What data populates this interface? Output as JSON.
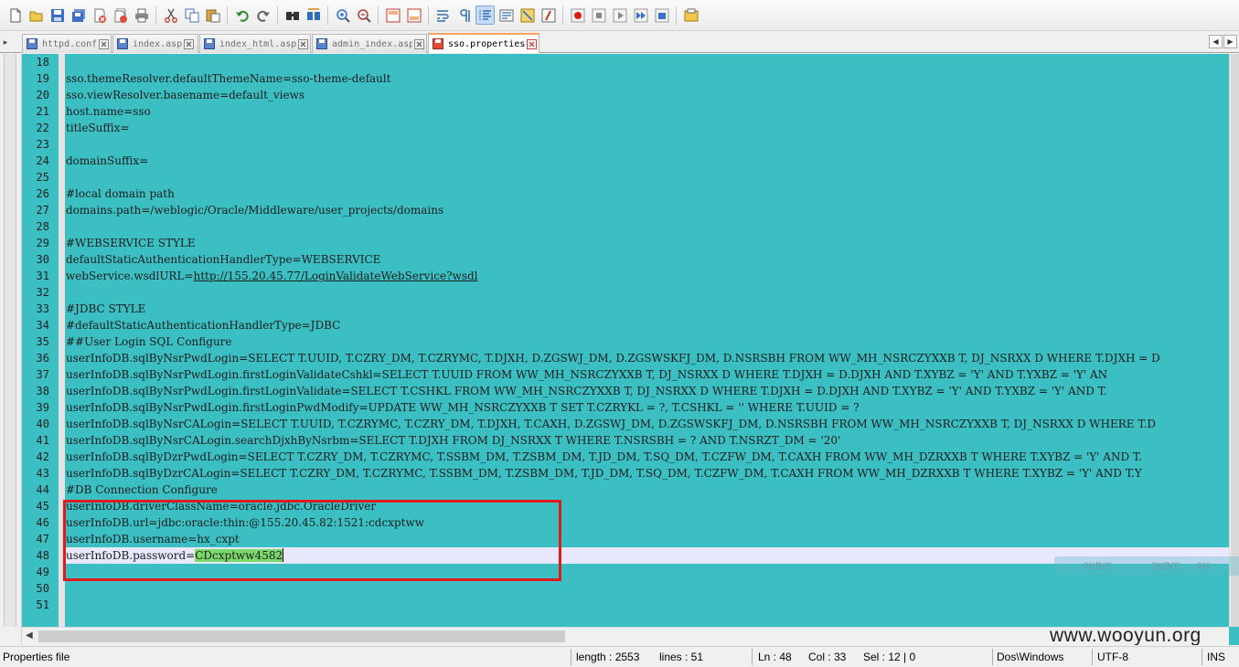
{
  "tabs": [
    {
      "label": "httpd.conf",
      "active": false
    },
    {
      "label": "index.asp",
      "active": false
    },
    {
      "label": "index_html.asp",
      "active": false
    },
    {
      "label": "admin_index.asp",
      "active": false
    },
    {
      "label": "sso.properties",
      "active": true
    }
  ],
  "toolbar_icons": [
    "new-file-icon",
    "open-file-icon",
    "save-icon",
    "save-all-icon",
    "close-icon",
    "close-all-icon",
    "print-icon",
    "cut-icon",
    "copy-icon",
    "paste-icon",
    "undo-icon",
    "redo-icon",
    "find-icon",
    "replace-icon",
    "zoom-in-icon",
    "zoom-out-icon",
    "sync-vertical-icon",
    "sync-horizontal-icon",
    "word-wrap-icon",
    "show-all-chars-icon",
    "indent-guide-icon",
    "user-language-icon",
    "doc-map-icon",
    "function-list-icon",
    "record-macro-icon",
    "stop-macro-icon",
    "play-macro-icon",
    "run-macro-icon",
    "save-macro-icon"
  ],
  "editor": {
    "lines": [
      {
        "num": "18",
        "text": ""
      },
      {
        "num": "19",
        "text": "sso.themeResolver.defaultThemeName=sso-theme-default"
      },
      {
        "num": "20",
        "text": "sso.viewResolver.basename=default_views"
      },
      {
        "num": "21",
        "text": "host.name=sso"
      },
      {
        "num": "22",
        "text": "titleSuffix="
      },
      {
        "num": "23",
        "text": ""
      },
      {
        "num": "24",
        "text": "domainSuffix="
      },
      {
        "num": "25",
        "text": ""
      },
      {
        "num": "26",
        "text": "#local domain path"
      },
      {
        "num": "27",
        "text": "domains.path=/weblogic/Oracle/Middleware/user_projects/domains"
      },
      {
        "num": "28",
        "text": ""
      },
      {
        "num": "29",
        "text": "#WEBSERVICE STYLE"
      },
      {
        "num": "30",
        "text": "defaultStaticAuthenticationHandlerType=WEBSERVICE"
      },
      {
        "num": "31",
        "text": "webService.wsdlURL=",
        "url": "http://155.20.45.77/LoginValidateWebService?wsdl"
      },
      {
        "num": "32",
        "text": ""
      },
      {
        "num": "33",
        "text": "#JDBC STYLE"
      },
      {
        "num": "34",
        "text": "#defaultStaticAuthenticationHandlerType=JDBC"
      },
      {
        "num": "35",
        "text": "##User Login SQL Configure"
      },
      {
        "num": "36",
        "text": "userInfoDB.sqlByNsrPwdLogin=SELECT T.UUID, T.CZRY_DM, T.CZRYMC, T.DJXH, D.ZGSWJ_DM, D.ZGSWSKFJ_DM, D.NSRSBH FROM WW_MH_NSRCZYXXB T, DJ_NSRXX D WHERE T.DJXH = D"
      },
      {
        "num": "37",
        "text": "userInfoDB.sqlByNsrPwdLogin.firstLoginValidateCshkl=SELECT T.UUID FROM WW_MH_NSRCZYXXB T, DJ_NSRXX D WHERE T.DJXH = D.DJXH AND T.XYBZ = 'Y' AND T.YXBZ = 'Y' AN"
      },
      {
        "num": "38",
        "text": "userInfoDB.sqlByNsrPwdLogin.firstLoginValidate=SELECT T.CSHKL FROM WW_MH_NSRCZYXXB T, DJ_NSRXX D WHERE T.DJXH = D.DJXH AND T.XYBZ = 'Y' AND T.YXBZ = 'Y' AND T."
      },
      {
        "num": "39",
        "text": "userInfoDB.sqlByNsrPwdLogin.firstLoginPwdModify=UPDATE WW_MH_NSRCZYXXB T SET T.CZRYKL = ?, T.CSHKL = '' WHERE T.UUID = ?"
      },
      {
        "num": "40",
        "text": "userInfoDB.sqlByNsrCALogin=SELECT T.UUID, T.CZRYMC, T.CZRY_DM, T.DJXH, T.CAXH, D.ZGSWJ_DM, D.ZGSWSKFJ_DM, D.NSRSBH FROM WW_MH_NSRCZYXXB T, DJ_NSRXX D WHERE T.D"
      },
      {
        "num": "41",
        "text": "userInfoDB.sqlByNsrCALogin.searchDjxhByNsrbm=SELECT T.DJXH FROM DJ_NSRXX T WHERE T.NSRSBH = ? AND T.NSRZT_DM = '20'"
      },
      {
        "num": "42",
        "text": "userInfoDB.sqlByDzrPwdLogin=SELECT T.CZRY_DM, T.CZRYMC, T.SSBM_DM, T.ZSBM_DM, T.JD_DM, T.SQ_DM, T.CZFW_DM, T.CAXH FROM WW_MH_DZRXXB T WHERE T.XYBZ = 'Y' AND T."
      },
      {
        "num": "43",
        "text": "userInfoDB.sqlByDzrCALogin=SELECT T.CZRY_DM, T.CZRYMC, T.SSBM_DM, T.ZSBM_DM, T.JD_DM, T.SQ_DM, T.CZFW_DM, T.CAXH FROM WW_MH_DZRXXB T WHERE T.XYBZ = 'Y' AND T.Y"
      },
      {
        "num": "44",
        "text": "#DB Connection Configure"
      },
      {
        "num": "45",
        "text": "userInfoDB.driverClassName=oracle.jdbc.OracleDriver"
      },
      {
        "num": "46",
        "text": "userInfoDB.url=jdbc:oracle:thin:@155.20.45.82:1521:cdcxptww"
      },
      {
        "num": "47",
        "text": "userInfoDB.username=hx_cxpt"
      },
      {
        "num": "48",
        "text": "userInfoDB.password=",
        "selected": "CDcxptww4582",
        "current": true
      },
      {
        "num": "49",
        "text": ""
      },
      {
        "num": "50",
        "text": ""
      },
      {
        "num": "51",
        "text": ""
      }
    ]
  },
  "overlay": {
    "net_down": "0KB/S",
    "net_up": "0KB/S",
    "net_extra": "6%",
    "watermark": "www.wooyun.org"
  },
  "statusbar": {
    "file_type": "Properties file",
    "length": "length : 2553",
    "lines": "lines : 51",
    "ln": "Ln : 48",
    "col": "Col : 33",
    "sel": "Sel : 12 | 0",
    "eol": "Dos\\Windows",
    "encoding": "UTF-8",
    "mode": "INS"
  },
  "colors": {
    "editor_bg": "#3cbfc2",
    "current_line": "#e8e8ff",
    "selection": "#7bd96a",
    "highlight_box": "#e01b1b",
    "active_tab_accent": "#f4a460"
  }
}
